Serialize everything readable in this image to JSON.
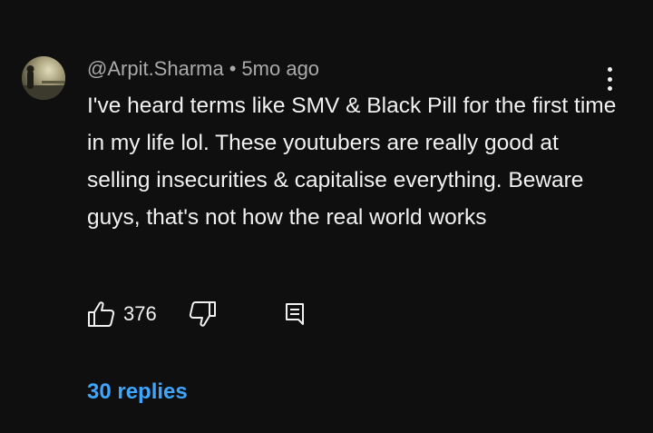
{
  "comment": {
    "author": "@Arpit.Sharma",
    "separator": "•",
    "time": "5mo ago",
    "text": "I've heard terms like SMV & Black Pill for the first time in my life lol. These youtubers are really good at selling insecurities & capitalise everything. Beware guys, that's not how the real world works",
    "likes": "376",
    "replies_label": "30 replies"
  },
  "icons": {
    "avatar": "avatar-photo",
    "more": "more-vertical-icon",
    "like": "thumbs-up-icon",
    "dislike": "thumbs-down-icon",
    "reply": "comment-icon"
  },
  "colors": {
    "background": "#0f0f0f",
    "text": "#f1f1f1",
    "meta": "#aaaaaa",
    "link": "#3ea6ff"
  }
}
